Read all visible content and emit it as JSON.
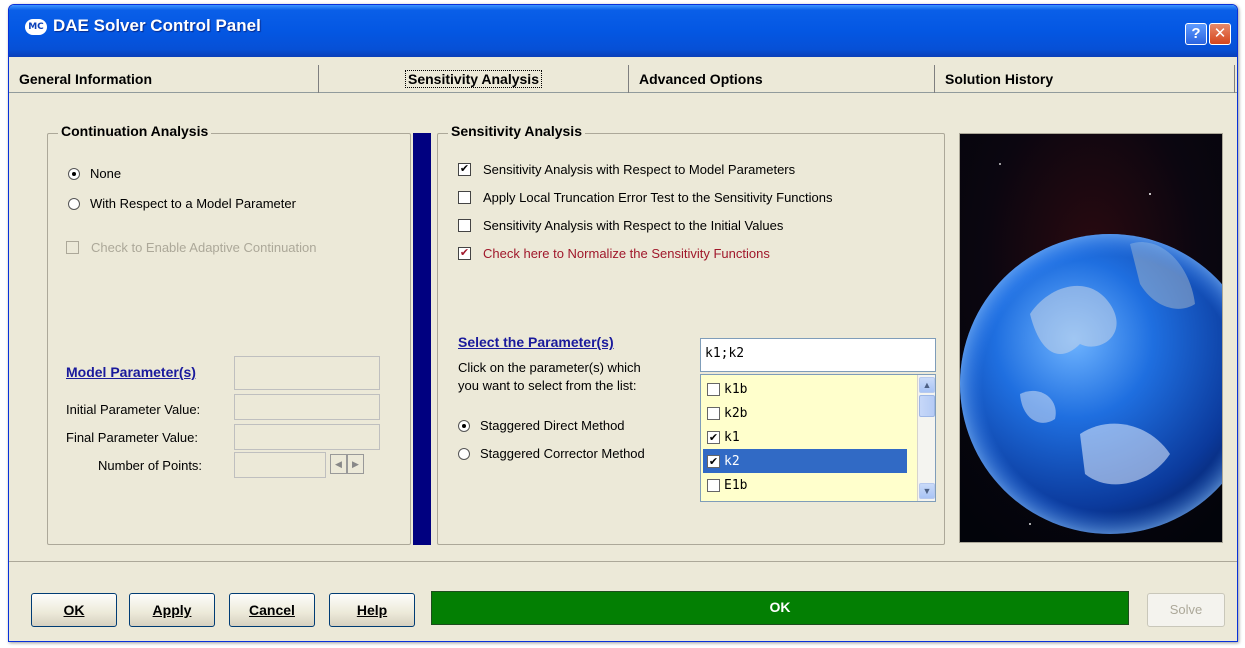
{
  "window": {
    "title": "DAE Solver Control Panel",
    "logo": "MC",
    "help_glyph": "?",
    "close_glyph": "✕"
  },
  "tabs": [
    {
      "label": "General Information",
      "active": false
    },
    {
      "label": "Sensitivity Analysis",
      "active": true
    },
    {
      "label": "Advanced Options",
      "active": false
    },
    {
      "label": "Solution History",
      "active": false
    }
  ],
  "continuation": {
    "title": "Continuation Analysis",
    "options": [
      {
        "label": "None",
        "selected": true
      },
      {
        "label": "With Respect to a Model Parameter",
        "selected": false
      }
    ],
    "adaptive_label": "Check to Enable Adaptive Continuation",
    "model_params_link": "Model Parameter(s)",
    "initial_label": "Initial Parameter Value:",
    "final_label": "Final Parameter Value:",
    "points_label": "Number of Points:"
  },
  "sensitivity": {
    "title": "Sensitivity Analysis",
    "checks": [
      {
        "label": "Sensitivity Analysis with Respect to Model Parameters",
        "checked": true
      },
      {
        "label": "Apply Local Truncation Error Test to the Sensitivity Functions",
        "checked": false
      },
      {
        "label": "Sensitivity Analysis with Respect to the Initial Values",
        "checked": false
      },
      {
        "label": "Check here to Normalize the Sensitivity Functions",
        "checked": true
      }
    ],
    "select_link": "Select the Parameter(s)",
    "instruction_1": "Click on the parameter(s) which",
    "instruction_2": "you want to select from the list:",
    "methods": [
      {
        "label": "Staggered Direct Method",
        "selected": true
      },
      {
        "label": "Staggered Corrector Method",
        "selected": false
      }
    ],
    "selected_text": "k1;k2",
    "params": [
      {
        "name": "k1b",
        "checked": false,
        "highlighted": false
      },
      {
        "name": "k2b",
        "checked": false,
        "highlighted": false
      },
      {
        "name": "k1",
        "checked": true,
        "highlighted": false
      },
      {
        "name": "k2",
        "checked": true,
        "highlighted": true
      },
      {
        "name": "E1b",
        "checked": false,
        "highlighted": false
      }
    ]
  },
  "buttons": {
    "ok": "OK",
    "apply": "Apply",
    "cancel": "Cancel",
    "help": "Help",
    "solve": "Solve"
  },
  "status_text": "OK",
  "colors": {
    "title_blue": "#0457e3",
    "status_green": "#037f03",
    "divider_navy": "#000080",
    "selection_blue": "#316ac5",
    "listbox_yellow": "#ffffcc",
    "normalize_red": "#a0182b"
  }
}
